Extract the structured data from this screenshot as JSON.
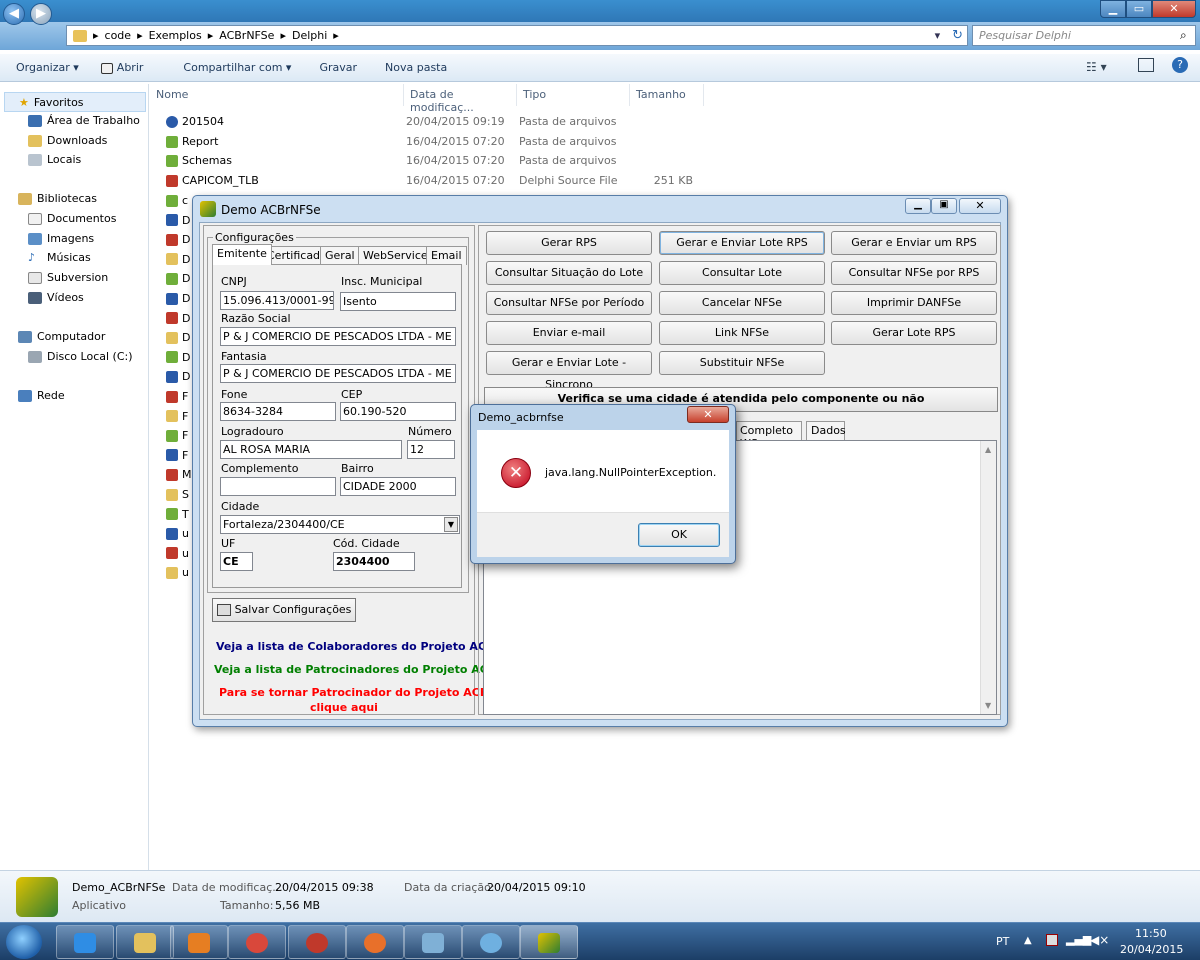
{
  "explorer": {
    "breadcrumb": [
      "code",
      "Exemplos",
      "ACBrNFSe",
      "Delphi"
    ],
    "search_placeholder": "Pesquisar Delphi",
    "commands": [
      "Organizar ▾",
      "Abrir",
      "Compartilhar com ▾",
      "Gravar",
      "Nova pasta"
    ],
    "nav": {
      "favoritos": "Favoritos",
      "area_trabalho": "Área de Trabalho",
      "downloads": "Downloads",
      "locais": "Locais",
      "bibliotecas": "Bibliotecas",
      "documentos": "Documentos",
      "imagens": "Imagens",
      "musicas": "Músicas",
      "subversion": "Subversion",
      "videos": "Vídeos",
      "computador": "Computador",
      "disco": "Disco Local (C:)",
      "rede": "Rede"
    },
    "columns": {
      "name": "Nome",
      "date": "Data de modificaç...",
      "type": "Tipo",
      "size": "Tamanho"
    },
    "files": [
      {
        "name": "201504",
        "date": "20/04/2015 09:19",
        "type": "Pasta de arquivos",
        "size": ""
      },
      {
        "name": "Report",
        "date": "16/04/2015 07:20",
        "type": "Pasta de arquivos",
        "size": ""
      },
      {
        "name": "Schemas",
        "date": "16/04/2015 07:20",
        "type": "Pasta de arquivos",
        "size": ""
      },
      {
        "name": "CAPICOM_TLB",
        "date": "16/04/2015 07:20",
        "type": "Delphi Source File",
        "size": "251 KB"
      }
    ],
    "partial_rows": [
      "c",
      "D",
      "D",
      "D",
      "D",
      "D",
      "D",
      "D",
      "D",
      "D",
      "F",
      "F",
      "F",
      "F",
      "M",
      "S",
      "T",
      "u",
      "u",
      "u"
    ],
    "details": {
      "name": "Demo_ACBrNFSe",
      "kind": "Aplicativo",
      "mod_label": "Data de modificaç...",
      "mod_value": "20/04/2015 09:38",
      "created_label": "Data da criação:",
      "created_value": "20/04/2015 09:10",
      "size_label": "Tamanho:",
      "size_value": "5,56 MB"
    }
  },
  "taskbar": {
    "lang": "PT",
    "time": "11:50",
    "date": "20/04/2015"
  },
  "app": {
    "title": "Demo ACBrNFSe",
    "group_label": "Configurações",
    "tabs": [
      "Emitente",
      "Certificado",
      "Geral",
      "WebService",
      "Email"
    ],
    "fields": {
      "cnpj_label": "CNPJ",
      "cnpj": "15.096.413/0001-99",
      "im_label": "Insc. Municipal",
      "im": "Isento",
      "razao_label": "Razão Social",
      "razao": "P & J COMERCIO DE PESCADOS LTDA - ME",
      "fantasia_label": "Fantasia",
      "fantasia": "P & J COMERCIO DE PESCADOS LTDA - ME",
      "fone_label": "Fone",
      "fone": "8634-3284",
      "cep_label": "CEP",
      "cep": "60.190-520",
      "logradouro_label": "Logradouro",
      "logradouro": "AL ROSA MARIA",
      "numero_label": "Número",
      "numero": "12",
      "complemento_label": "Complemento",
      "complemento": "",
      "bairro_label": "Bairro",
      "bairro": "CIDADE 2000",
      "cidade_label": "Cidade",
      "cidade": "Fortaleza/2304400/CE",
      "uf_label": "UF",
      "uf": "CE",
      "codcidade_label": "Cód. Cidade",
      "codcidade": "2304400"
    },
    "save_button": "Salvar Configurações",
    "links": {
      "colaboradores": "Veja a lista de Colaboradores do Projeto ACBr",
      "patrocinadores": "Veja a lista de Patrocinadores do Projeto ACBr",
      "tornar1": "Para se tornar Patrocinador do Projeto ACBr,",
      "tornar2": "clique aqui"
    },
    "actions": [
      "Gerar RPS",
      "Gerar e Enviar Lote RPS",
      "Gerar e Enviar um RPS",
      "Consultar Situação do Lote",
      "Consultar Lote",
      "Consultar NFSe por RPS",
      "Consultar NFSe por Período",
      "Cancelar NFSe",
      "Imprimir DANFSe",
      "Enviar e-mail",
      "Link NFSe",
      "Gerar Lote RPS",
      "Gerar e Enviar Lote - Sincrono",
      "Substituir NFSe"
    ],
    "verify_button": "Verifica se uma cidade é atendida pelo componente ou não",
    "result_tabs": [
      "Completo WS",
      "Dados"
    ],
    "colors": {
      "blue_link": "#00007f",
      "green_link": "#007f00",
      "red_link": "#ff0000"
    }
  },
  "dialog": {
    "title": "Demo_acbrnfse",
    "message": "java.lang.NullPointerException.",
    "ok": "OK"
  }
}
